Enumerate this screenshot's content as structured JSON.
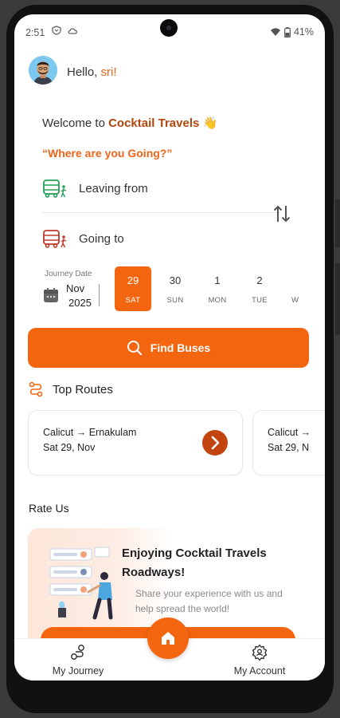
{
  "status_bar": {
    "time": "2:51",
    "battery": "41%"
  },
  "header": {
    "greeting_prefix": "Hello, ",
    "user_name": "sri!"
  },
  "welcome": {
    "prefix": "Welcome to ",
    "brand": "Cocktail Travels",
    "emoji": "👋"
  },
  "question": "“Where are you Going?”",
  "search": {
    "leaving_label": "Leaving from",
    "going_label": "Going to"
  },
  "journey_date": {
    "label": "Journey Date",
    "month": "Nov",
    "year": "2025"
  },
  "dates": [
    {
      "num": "29",
      "day": "SAT",
      "selected": true
    },
    {
      "num": "30",
      "day": "SUN",
      "selected": false
    },
    {
      "num": "1",
      "day": "MON",
      "selected": false
    },
    {
      "num": "2",
      "day": "TUE",
      "selected": false
    },
    {
      "num": "",
      "day": "W",
      "selected": false
    }
  ],
  "find_button": "Find Buses",
  "top_routes": {
    "title": "Top Routes",
    "routes": [
      {
        "from": "Calicut",
        "to": "Ernakulam",
        "date": "Sat 29, Nov"
      },
      {
        "from": "Calicut",
        "to": "",
        "date": "Sat 29, N"
      }
    ]
  },
  "rate_us": {
    "title": "Rate Us",
    "heading": "Enjoying Cocktail Travels Roadways!",
    "subtext": "Share your experience with us and help spread the world!"
  },
  "bottom_nav": {
    "journey": "My Journey",
    "account": "My Account"
  },
  "colors": {
    "accent": "#f4650f",
    "brand_dark": "#b4450d",
    "route_button": "#c2440f"
  }
}
